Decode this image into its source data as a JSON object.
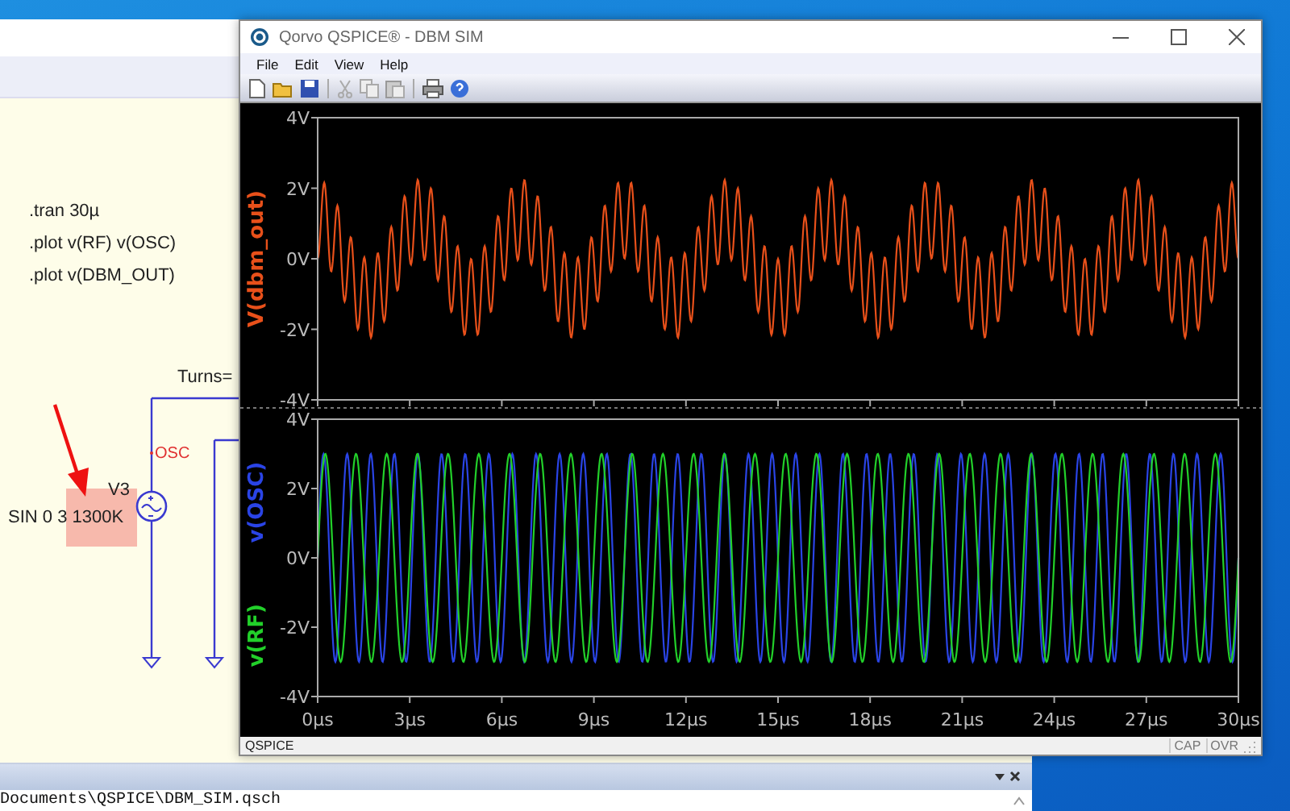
{
  "schematic": {
    "directives": [
      ".tran 30µ",
      ".plot v(RF) v(OSC)",
      ".plot  v(DBM_OUT)"
    ],
    "turns_label": "Turns=",
    "net_label": "OSC",
    "source_name": "V3",
    "source_value": "SIN 0 3 1300K"
  },
  "window": {
    "title": "Qorvo QSPICE® - DBM SIM",
    "menu": [
      "File",
      "Edit",
      "View",
      "Help"
    ]
  },
  "plots": [
    {
      "traces": [
        {
          "label": "V(dbm_out)",
          "color": "#e8501a"
        }
      ],
      "yticks": [
        "4V",
        "2V",
        "0V",
        "-2V",
        "-4V"
      ]
    },
    {
      "traces": [
        {
          "label": "v(OSC)",
          "color": "#2a44e6"
        },
        {
          "label": "v(RF)",
          "color": "#22d02a"
        }
      ],
      "yticks": [
        "4V",
        "2V",
        "0V",
        "-2V",
        "-4V"
      ]
    }
  ],
  "xticks": [
    "0µs",
    "3µs",
    "6µs",
    "9µs",
    "12µs",
    "15µs",
    "18µs",
    "21µs",
    "24µs",
    "27µs",
    "30µs"
  ],
  "status_bar": {
    "left": "QSPICE",
    "indicators": [
      "CAP",
      "OVR"
    ]
  },
  "output_panel": {
    "path": "Documents\\QSPICE\\DBM_SIM.qsch"
  }
}
